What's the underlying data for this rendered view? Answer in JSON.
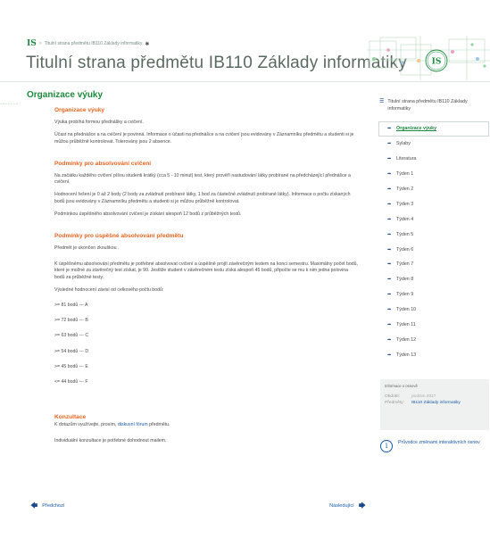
{
  "header": {
    "logo_glyph": "IS",
    "breadcrumb_sep": ">",
    "breadcrumb": "Titulní strana předmětu IB110 Základy informatiky",
    "pin_icon": "pin-icon",
    "title": "Titulní strana předmětu IB110 Základy informatiky",
    "deco_glyph": "IS"
  },
  "dots": "·······",
  "main": {
    "heading": "Organizace výuky",
    "sections": {
      "org": {
        "title": "Organizace výuky",
        "p1": "Výuka probíhá formou přednášky a cvičení.",
        "p2": "Účast na přednášce a na cvičení je povinná. Informace o účasti na přednášce a na cvičení jsou evidovány v Záznamníku předmětu a studenti si je můžou průběžně kontrolovat. Tolerovány jsou 2 absence."
      },
      "cond_ex": {
        "title": "Podmínky pro absolvování cvičení",
        "p1": "Na začátku každého cvičení píšou studenti krátký (cca 5 - 10 minut) test, který prověří nastudování látky probírané na předcházející přednášce a cvičení.",
        "p2": "Hodnocení řešení je 0 až 2 body (2 body za zvládnutí probírané látky, 1 bod za částečné zvládnutí probírané látky). Informace o počtu získaných bodů jsou evidovány v Záznamníku předmětu a studenti si je můžou průběžně kontrolovat.",
        "p3": "Podmínkou úspěšného absolvování cvičení je získání alespoň 12 bodů z průběžných testů."
      },
      "cond_course": {
        "title": "Podmínky pro úspěšné absolvování předmětu",
        "p1": "Předmět je ukončen zkouškou .",
        "p2": "K úspěšnému absolvování předmětu je potřebné absolvovat cvičení a úspěšně projít závěrečným testem na konci semestru. Maximálny počet bodů, které je možné za závěrečný test získat, je 90. Jestliže student v závěrečném testu získá alespoň 45 bodů, připočte se mu k nim jedna polovina bodů za průběžné testy.",
        "p3": "Výsledné hodnocení závisí od celkového počtu bodů:",
        "grades": [
          ">= 81 bodů --- A",
          ">= 72 bodů --- B",
          ">= 63 bodů --- C",
          ">= 54 bodů --- D",
          ">= 45 bodů --- E",
          "<= 44 bodů --- F"
        ]
      },
      "consult": {
        "title": "Konzultace",
        "p1_before": "K dotazům využívejte, prosím, ",
        "p1_link": "diskusní fórum",
        "p1_after": " předmětu.",
        "p2": "Individuální konzultace je potřebné dohodnout mailem."
      }
    }
  },
  "nav": {
    "prev": "Předchozí",
    "next": "Následující"
  },
  "sidebar": {
    "heading": "Titulní strana předmětu IB110 Základy informatiky",
    "items": [
      "Organizace výuky",
      "Sylaby",
      "Literatura",
      "Týden 1",
      "Týden 2",
      "Týden 3",
      "Týden 4",
      "Týden 5",
      "Týden 6",
      "Týden 7",
      "Týden 8",
      "Týden 9",
      "Týden 10",
      "Týden 11",
      "Týden 12",
      "Týden 13"
    ],
    "active_index": 0
  },
  "info": {
    "title": "Informace o osnově",
    "period_label": "Období:",
    "period_value": "podzim 2017",
    "subjects_label": "Předměty:",
    "subjects_value": "IB110 Základy informatiky"
  },
  "guide": {
    "glyph": "i",
    "label": "Průvodce změnami interaktivních osnov"
  },
  "colors": {
    "green": "#1c8a3e",
    "orange": "#e8641e",
    "link": "#1a5aa8"
  }
}
